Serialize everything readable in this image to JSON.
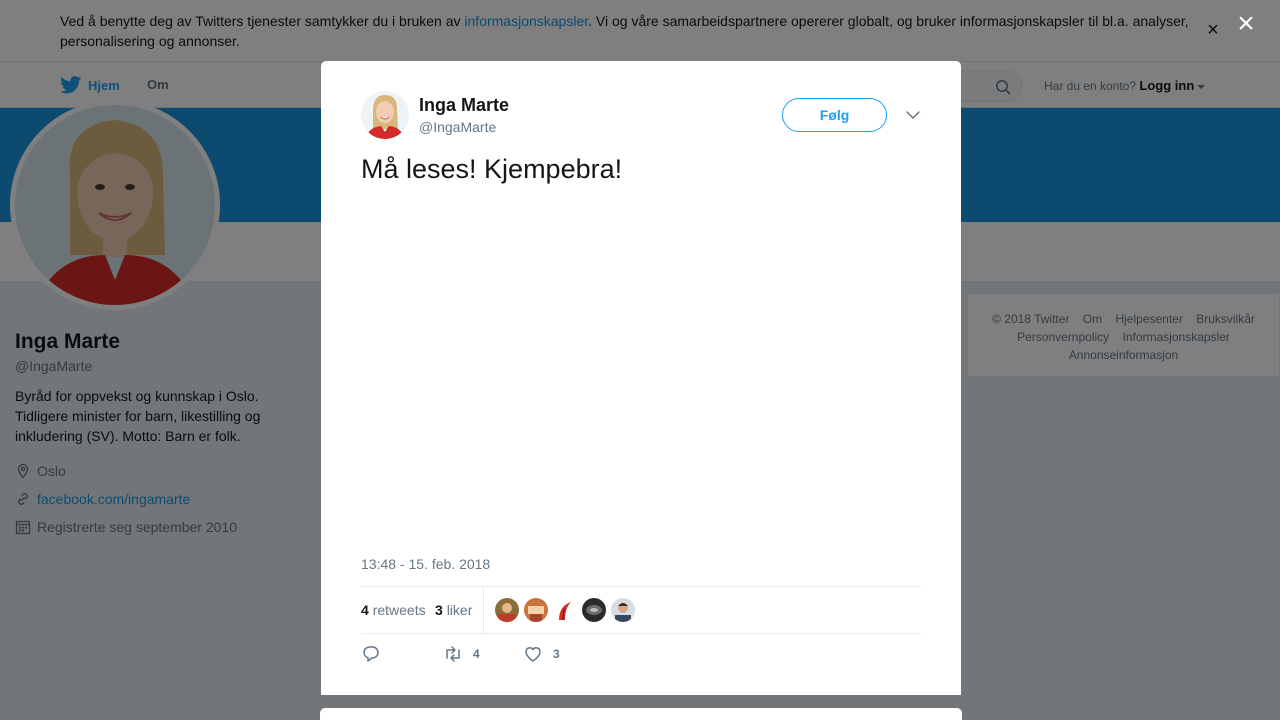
{
  "cookie_banner": {
    "text_before": "Ved å benytte deg av Twitters tjenester samtykker du i bruken av ",
    "link": "informasjonskapsler",
    "text_after": ". Vi og våre samarbeidspartnere opererer globalt, og bruker informasjonskapsler til bl.a. analyser, personalisering og annonser.",
    "close": "×"
  },
  "nav": {
    "home": "Hjem",
    "about": "Om",
    "login_prompt": "Har du en konto?",
    "login": "Logg inn"
  },
  "profile": {
    "name": "Inga Marte",
    "handle": "@IngaMarte",
    "bio": "Byråd for oppvekst og kunnskap i Oslo. Tidligere minister for barn, likestilling og inkludering (SV). Motto: Barn er folk.",
    "location": "Oslo",
    "url": "facebook.com/ingamarte",
    "joined": "Registrerte seg september 2010"
  },
  "footer": {
    "links": [
      "© 2018 Twitter",
      "Om",
      "Hjelpesenter",
      "Bruksvilkår",
      "Personvernpolicy",
      "Informasjonskapsler",
      "Annonseinformasjon"
    ]
  },
  "overlay": {
    "close": "×"
  },
  "tweet": {
    "name": "Inga Marte",
    "handle": "@IngaMarte",
    "follow": "Følg",
    "text": "Må leses! Kjempebra!",
    "timestamp": "13:48 - 15. feb. 2018",
    "retweets_count": "4",
    "retweets_label": "retweets",
    "likes_count": "3",
    "likes_label": "liker",
    "retweet_action_count": "4",
    "like_action_count": "3"
  },
  "colors": {
    "accent": "#1da1f2",
    "link": "#1b95e0",
    "banner": "#1b95e0"
  }
}
